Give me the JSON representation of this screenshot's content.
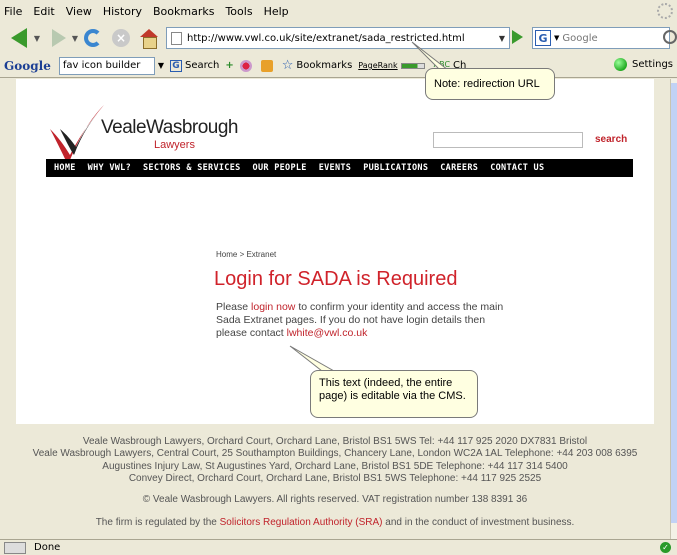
{
  "menu": [
    "File",
    "Edit",
    "View",
    "History",
    "Bookmarks",
    "Tools",
    "Help"
  ],
  "navbar": {
    "url": "http://www.vwl.co.uk/site/extranet/sada_restricted.html",
    "search_placeholder": "Google"
  },
  "google_toolbar": {
    "logo": "Google",
    "query": "fav icon builder",
    "search_label": "Search",
    "bookmarks_label": "Bookmarks",
    "pagerank_label": "PageRank",
    "check_label": "Ch",
    "settings_label": "Settings"
  },
  "site": {
    "logo_name": "VealeWasbrough",
    "logo_sub": "Lawyers",
    "search_label": "search",
    "nav": [
      "HOME",
      "WHY VWL?",
      "SECTORS & SERVICES",
      "OUR PEOPLE",
      "EVENTS",
      "PUBLICATIONS",
      "CAREERS",
      "CONTACT US"
    ],
    "breadcrumb": "Home > Extranet",
    "heading": "Login for SADA is Required",
    "body": {
      "before_link": "Please ",
      "login_link": "login now",
      "after_link": " to confirm your identity and access the main Sada Extranet pages.  If you do not have login details then please contact ",
      "email_link": "lwhite@vwl.co.uk"
    }
  },
  "footer": {
    "lines": [
      "Veale Wasbrough Lawyers, Orchard Court, Orchard Lane, Bristol BS1 5WS Tel: +44 117 925 2020 DX7831 Bristol",
      "Veale Wasbrough Lawyers, Central Court, 25 Southampton Buildings, Chancery Lane, London WC2A 1AL Telephone: +44 203 008 6395",
      "Augustines Injury Law, St Augustines Yard, Orchard Lane, Bristol BS1 5DE Telephone: +44 117 314 5400",
      "Convey Direct, Orchard Court, Orchard Lane, Bristol BS1 5WS Telephone: +44 117 925 2525"
    ],
    "copyright": "© Veale Wasbrough Lawyers. All rights reserved. VAT registration number 138 8391 36",
    "regulated_before": "The firm is regulated by the ",
    "regulated_link": "Solicitors Regulation Authority (SRA)",
    "regulated_after": " and in the conduct of investment business."
  },
  "callouts": {
    "redirect": "Note: redirection URL",
    "editable": "This text (indeed, the entire page) is editable via the CMS."
  },
  "status": {
    "text": "Done"
  }
}
